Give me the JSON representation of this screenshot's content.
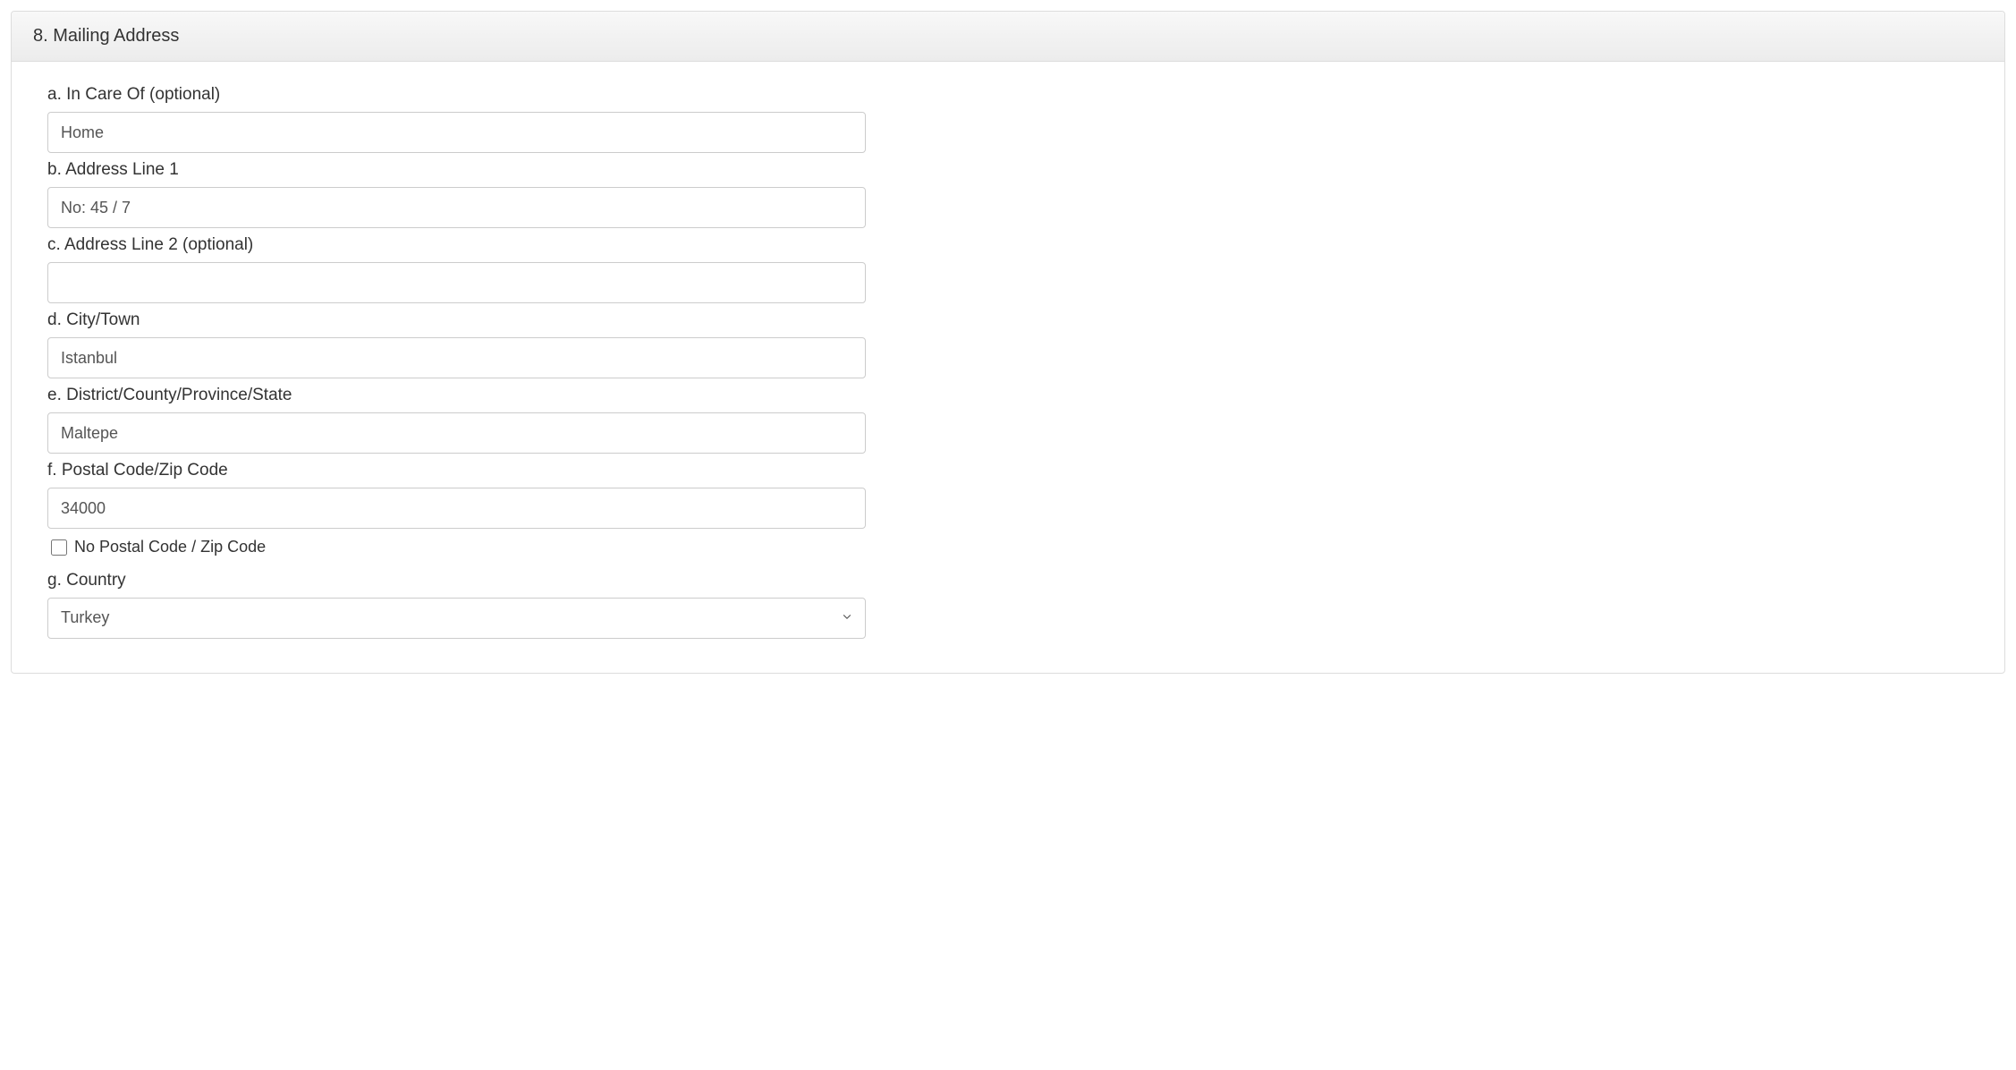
{
  "section": {
    "title": "8. Mailing Address"
  },
  "fields": {
    "in_care_of": {
      "label": "a. In Care Of (optional)",
      "value": "Home"
    },
    "address_line_1": {
      "label": "b. Address Line 1",
      "value": "No: 45 / 7"
    },
    "address_line_2": {
      "label": "c. Address Line 2 (optional)",
      "value": ""
    },
    "city": {
      "label": "d. City/Town",
      "value": "Istanbul"
    },
    "district": {
      "label": "e. District/County/Province/State",
      "value": "Maltepe"
    },
    "postal": {
      "label": "f. Postal Code/Zip Code",
      "value": "34000",
      "no_postal_label": "No Postal Code / Zip Code",
      "no_postal_checked": false
    },
    "country": {
      "label": "g. Country",
      "value": "Turkey"
    }
  }
}
